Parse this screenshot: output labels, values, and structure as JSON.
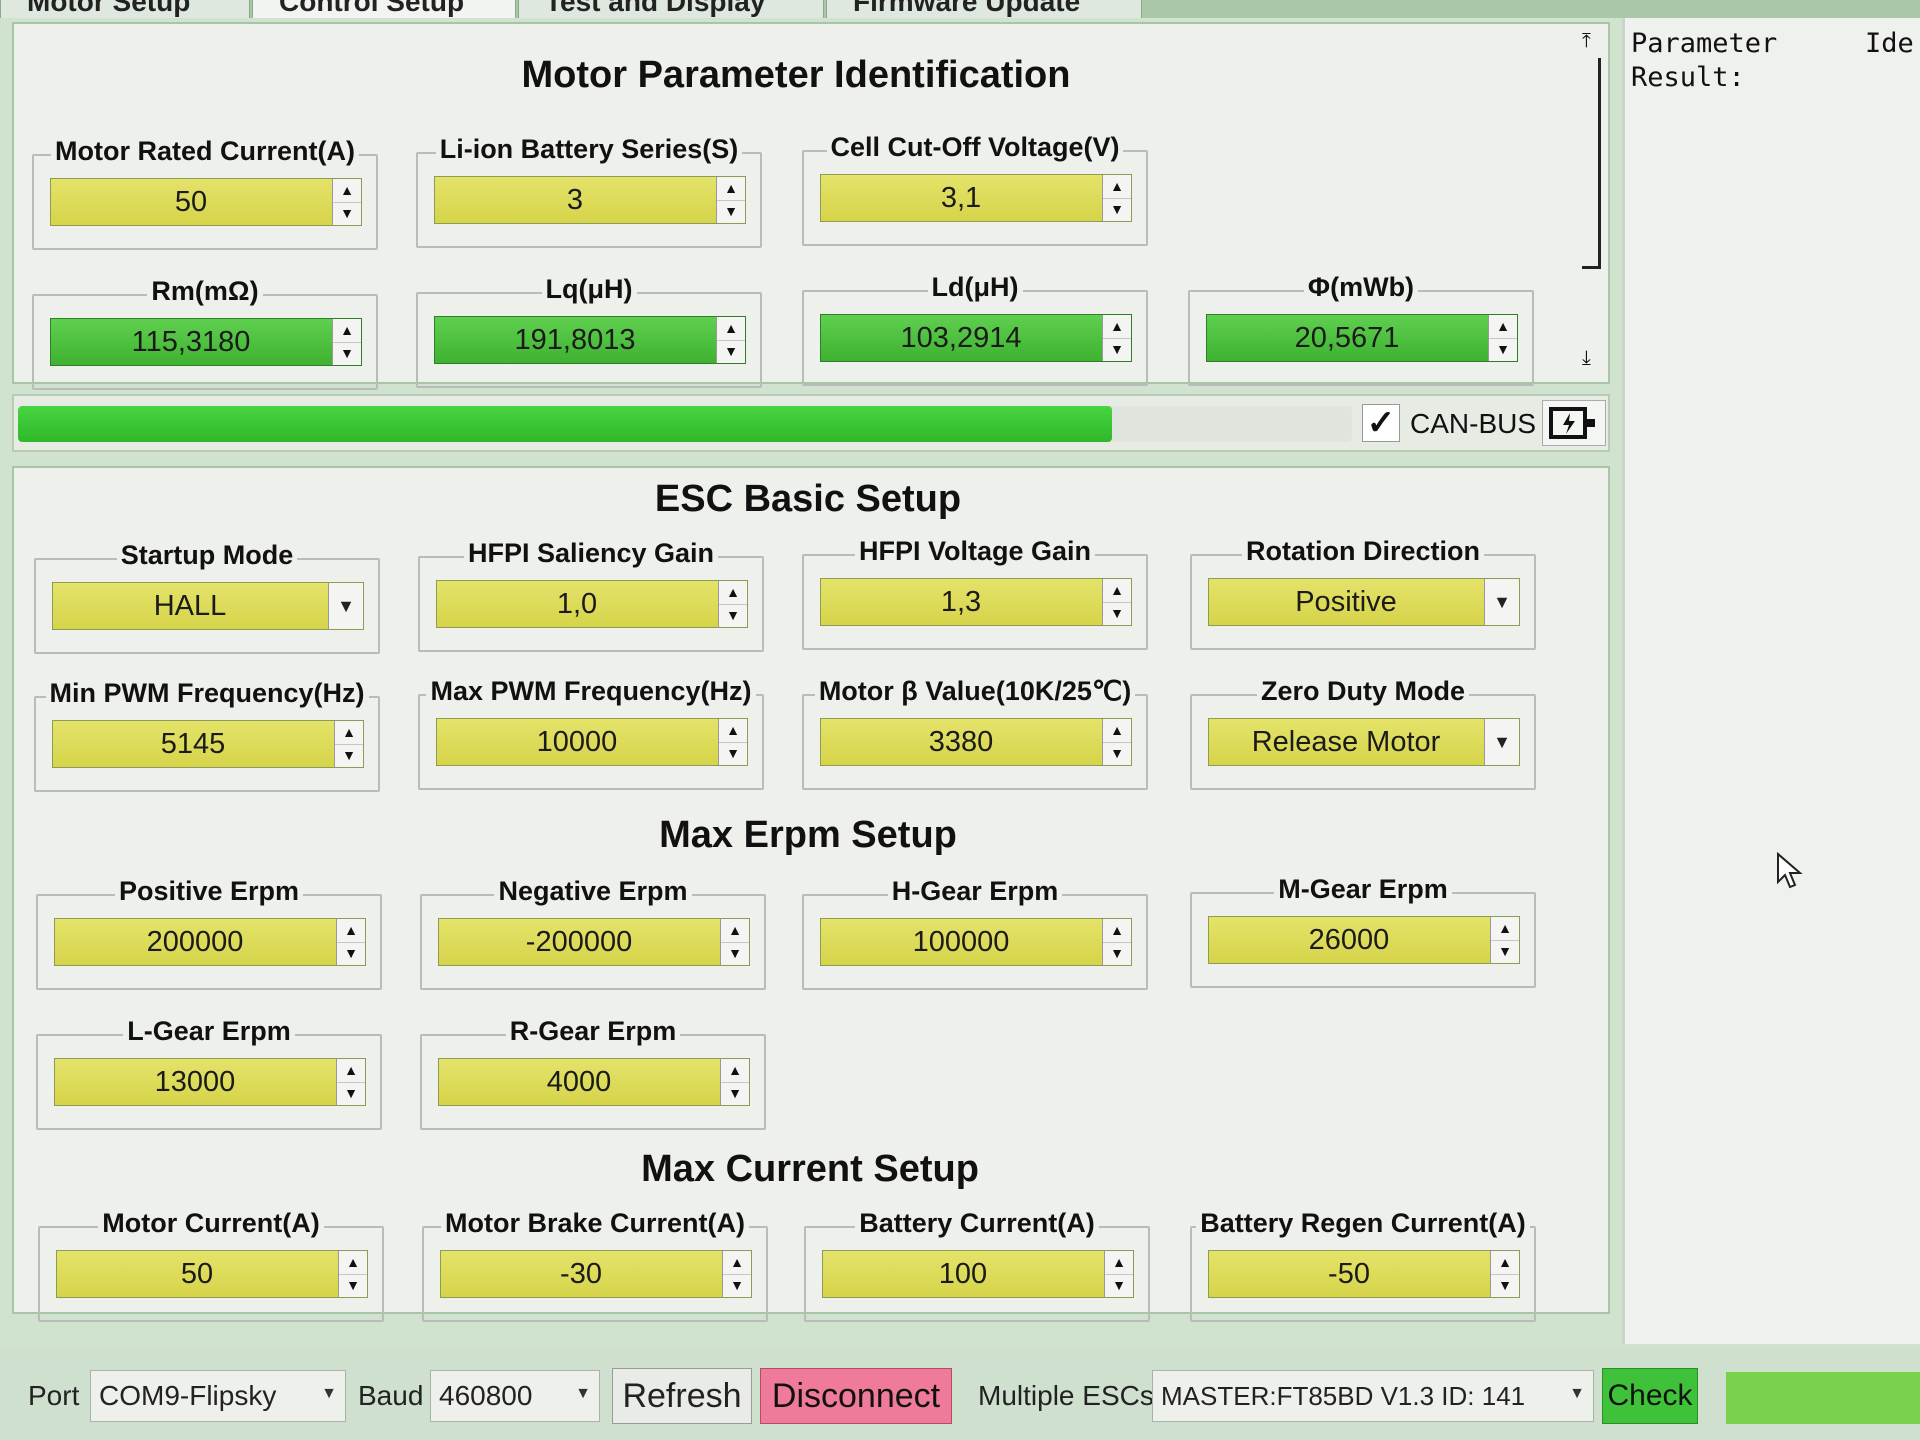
{
  "tabs": [
    "Motor Setup",
    "Control Setup",
    "Test and Display",
    "Firmware Update"
  ],
  "motor_section": {
    "title": "Motor Parameter Identification",
    "fields": [
      {
        "label": "Motor Rated Current(A)",
        "value": "50"
      },
      {
        "label": "Li-ion Battery Series(S)",
        "value": "3"
      },
      {
        "label": "Cell Cut-Off Voltage(V)",
        "value": "3,1"
      },
      {
        "label": "Rm(mΩ)",
        "value": "115,3180"
      },
      {
        "label": "Lq(μH)",
        "value": "191,8013"
      },
      {
        "label": "Ld(μH)",
        "value": "103,2914"
      },
      {
        "label": "Φ(mWb)",
        "value": "20,5671"
      }
    ]
  },
  "progress": {
    "fill": 0.82,
    "can_label": "CAN-BUS",
    "checked_glyph": "✓"
  },
  "esc_section": {
    "title": "ESC Basic Setup",
    "fields": [
      {
        "label": "Startup Mode",
        "value": "HALL"
      },
      {
        "label": "HFPI Saliency Gain",
        "value": "1,0"
      },
      {
        "label": "HFPI Voltage Gain",
        "value": "1,3"
      },
      {
        "label": "Rotation Direction",
        "value": "Positive"
      },
      {
        "label": "Min PWM Frequency(Hz)",
        "value": "5145"
      },
      {
        "label": "Max PWM Frequency(Hz)",
        "value": "10000"
      },
      {
        "label": "Motor β Value(10K/25℃)",
        "value": "3380"
      },
      {
        "label": "Zero Duty Mode",
        "value": "Release Motor"
      }
    ]
  },
  "erpm_section": {
    "title": "Max Erpm Setup",
    "fields": [
      {
        "label": "Positive Erpm",
        "value": "200000"
      },
      {
        "label": "Negative Erpm",
        "value": "-200000"
      },
      {
        "label": "H-Gear Erpm",
        "value": "100000"
      },
      {
        "label": "M-Gear Erpm",
        "value": "26000"
      },
      {
        "label": "L-Gear Erpm",
        "value": "13000"
      },
      {
        "label": "R-Gear Erpm",
        "value": "4000"
      }
    ]
  },
  "current_section": {
    "title": "Max Current Setup",
    "fields": [
      {
        "label": "Motor Current(A)",
        "value": "50"
      },
      {
        "label": "Motor Brake Current(A)",
        "value": "-30"
      },
      {
        "label": "Battery Current(A)",
        "value": "100"
      },
      {
        "label": "Battery Regen Current(A)",
        "value": "-50"
      }
    ]
  },
  "right_pane": {
    "line1": "Parameter",
    "line1b": "Ide",
    "line2": "Result:"
  },
  "toolbar": {
    "port_label": "Port",
    "port_value": "COM9-Flipsky",
    "baud_label": "Baud",
    "baud_value": "460800",
    "refresh_label": "Refresh",
    "disconnect_label": "Disconnect",
    "multi_label": "Multiple ESCs",
    "esc_value": "MASTER:FT85BD V1.3 ID: 141",
    "check_label": "Check"
  },
  "colors": {
    "field_yellow": "#dcdb55",
    "field_green": "#4cc03e",
    "disconnect": "#f07a9a",
    "progress": "#3cc535"
  }
}
